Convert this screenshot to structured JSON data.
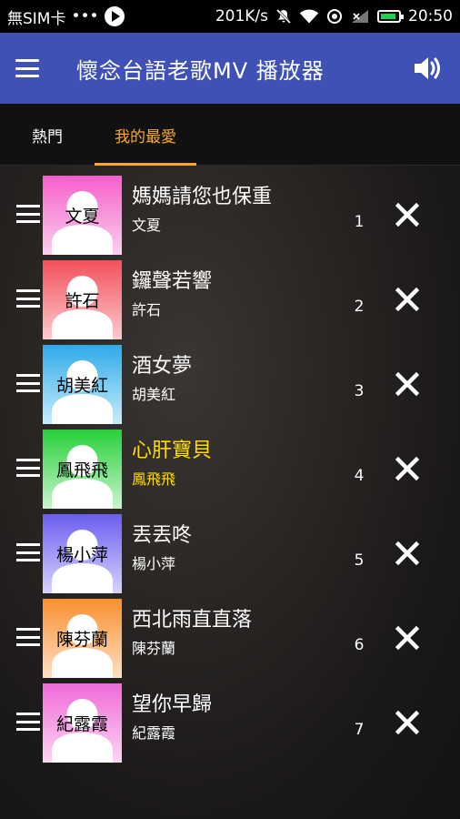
{
  "status_bar": {
    "carrier": "無SIM卡",
    "dots": "•••",
    "speed": "201K/s",
    "time": "20:50",
    "battery_color": "#19d34b"
  },
  "app_bar": {
    "title": "懷念台語老歌MV 播放器",
    "menu_icon": "menu-icon",
    "volume_icon": "volume-icon",
    "color": "#3f51b5"
  },
  "tabs": [
    {
      "label": "熱門",
      "active": false
    },
    {
      "label": "我的最愛",
      "active": true
    }
  ],
  "accent_color": "#ffa726",
  "songs": [
    {
      "title": "媽媽請您也保重",
      "artist": "文夏",
      "thumb_label": "文夏",
      "number": "1",
      "color_top": "#f65fc9",
      "color_bottom": "#fbd0ee",
      "playing": false
    },
    {
      "title": "鑼聲若響",
      "artist": "許石",
      "thumb_label": "許石",
      "number": "2",
      "color_top": "#f2505b",
      "color_bottom": "#fccbcf",
      "playing": false
    },
    {
      "title": "酒女夢",
      "artist": "胡美紅",
      "thumb_label": "胡美紅",
      "number": "3",
      "color_top": "#2eaae8",
      "color_bottom": "#c8ecfb",
      "playing": false
    },
    {
      "title": "心肝寶貝",
      "artist": "鳳飛飛",
      "thumb_label": "鳳飛飛",
      "number": "4",
      "color_top": "#27d03a",
      "color_bottom": "#c9f5cd",
      "playing": true
    },
    {
      "title": "丟丟咚",
      "artist": "楊小萍",
      "thumb_label": "楊小萍",
      "number": "5",
      "color_top": "#6a5ef0",
      "color_bottom": "#d8d4fc",
      "playing": false
    },
    {
      "title": "西北雨直直落",
      "artist": "陳芬蘭",
      "thumb_label": "陳芬蘭",
      "number": "6",
      "color_top": "#f8902f",
      "color_bottom": "#fde0c4",
      "playing": false
    },
    {
      "title": "望你早歸",
      "artist": "紀露霞",
      "thumb_label": "紀露霞",
      "number": "7",
      "color_top": "#f06ad8",
      "color_bottom": "#fbd6f3",
      "playing": false
    }
  ],
  "playing_color": "#ffdd00"
}
